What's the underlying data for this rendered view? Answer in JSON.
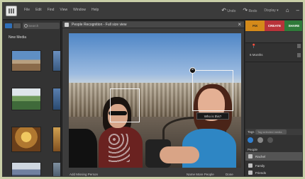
{
  "menubar": {
    "items": [
      "File",
      "Edit",
      "Find",
      "View",
      "Window",
      "Help"
    ],
    "right": [
      "Undo",
      "Redo",
      "Display"
    ]
  },
  "left": {
    "search_placeholder": "Search",
    "section_label": "New Media"
  },
  "dialog": {
    "title": "People Recognition - Full size view",
    "name_tag": "Who is this?",
    "add_missing": "Add Missing Person",
    "name_more": "Name More People",
    "done": "Done"
  },
  "right": {
    "tabs": [
      "FIX",
      "CREATE",
      "SHARE"
    ],
    "months": "6 Months",
    "tags_label": "Tags",
    "tag_search_placeholder": "Tag selected media",
    "people_label": "People",
    "people": [
      "Rachel",
      "Family",
      "Friends"
    ]
  },
  "colors": {
    "fix_tab": "#d48a1a",
    "create_tab": "#b8333a",
    "share_tab": "#2f7a3a",
    "accent": "#2f6fb8"
  }
}
